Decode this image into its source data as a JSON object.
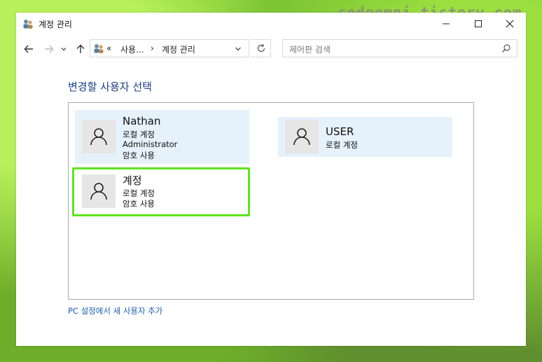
{
  "watermark": "codeomni.tistory.com",
  "window": {
    "title": "계정 관리",
    "icon": "users-icon",
    "controls": [
      "minimize-icon",
      "maximize-icon",
      "close-icon"
    ]
  },
  "navigation": {
    "back": "back-arrow-icon",
    "forward": "forward-arrow-icon",
    "recent": "chevron-down-icon",
    "up": "up-arrow-icon",
    "address": {
      "overflow": "«",
      "crumb1": "사용...",
      "separator": "›",
      "crumb2": "계정 관리"
    },
    "refresh": "refresh-icon",
    "search_placeholder": "제어판 검색"
  },
  "main": {
    "heading": "변경할 사용자 선택",
    "accounts": [
      {
        "name": "Nathan",
        "type": "로컬 계정",
        "role": "Administrator",
        "password": "암호 사용"
      },
      {
        "name": "USER",
        "type": "로컬 계정"
      },
      {
        "name": "계정",
        "type": "로컬 계정",
        "password": "암호 사용"
      }
    ],
    "add_user_link": "PC 설정에서 새 사용자 추가"
  },
  "colors": {
    "card_bg": "#e5f1fb",
    "selected_border": "#5ce51e",
    "heading": "#1e3f8a",
    "link": "#1a5fb4"
  }
}
